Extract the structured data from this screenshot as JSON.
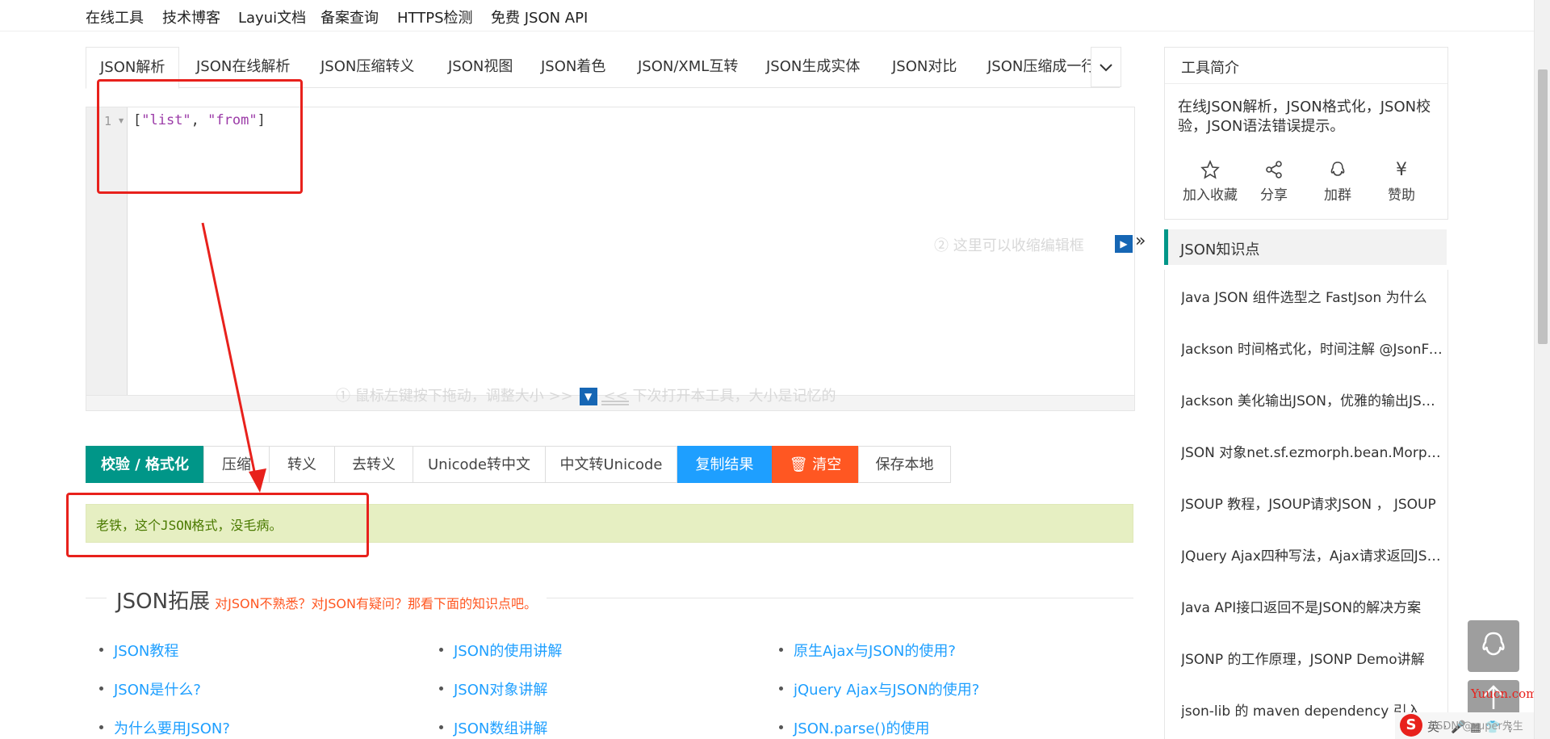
{
  "topnav": [
    "在线工具",
    "技术博客",
    "Layui文档",
    "备案查询",
    "HTTPS检测",
    "免费 JSON API"
  ],
  "tabs": [
    "JSON解析",
    "JSON在线解析",
    "JSON压缩转义",
    "JSON视图",
    "JSON着色",
    "JSON/XML互转",
    "JSON生成实体",
    "JSON对比",
    "JSON压缩成一行"
  ],
  "editor": {
    "line_number": "1",
    "code_open": "[",
    "str1": "\"list\"",
    "comma": ", ",
    "str2": "\"from\"",
    "code_close": "]",
    "hint_resize_left": "① 鼠标左键按下拖动，调整大小 >>",
    "hint_resize_right": "<< 下次打开本工具，大小是记忆的",
    "hint_collapse": "② 这里可以收缩编辑框"
  },
  "buttons": {
    "validate": "校验 / 格式化",
    "compress": "压缩",
    "escape": "转义",
    "unescape": "去转义",
    "unicode_to_cn": "Unicode转中文",
    "cn_to_unicode": "中文转Unicode",
    "copy": "复制结果",
    "clear": "清空",
    "save": "保存本地"
  },
  "result": "老铁，这个JSON格式，没毛病。",
  "extension": {
    "title": "JSON拓展",
    "subtitle": "对JSON不熟悉？对JSON有疑问？那看下面的知识点吧。",
    "col1": [
      "JSON教程",
      "JSON是什么?",
      "为什么要用JSON?"
    ],
    "col2": [
      "JSON的使用讲解",
      "JSON对象讲解",
      "JSON数组讲解"
    ],
    "col3": [
      "原生Ajax与JSON的使用?",
      "jQuery Ajax与JSON的使用?",
      "JSON.parse()的使用"
    ]
  },
  "sidebar": {
    "intro_title": "工具简介",
    "intro_desc": "在线JSON解析，JSON格式化，JSON校验，JSON语法错误提示。",
    "actions": [
      {
        "label": "加入收藏",
        "icon": "star-icon"
      },
      {
        "label": "分享",
        "icon": "share-icon"
      },
      {
        "label": "加群",
        "icon": "qq-icon"
      },
      {
        "label": "赞助",
        "icon": "yen-icon"
      }
    ],
    "knowledge_title": "JSON知识点",
    "knowledge_items": [
      "Java JSON 组件选型之 FastJson 为什么",
      "Jackson 时间格式化，时间注解 @JsonFormat",
      "Jackson 美化输出JSON，优雅的输出JSON数据",
      "JSON 对象net.sf.ezmorph.bean.MorphDynaBean",
      "JSOUP 教程，JSOUP请求JSON ， JSOUP",
      "JQuery Ajax四种写法，Ajax请求返回JSON",
      "Java API接口返回不是JSON的解决方案",
      "JSONP 的工作原理，JSONP Demo讲解",
      "json-lib 的 maven dependency 引入及Ja"
    ]
  },
  "watermark": "Yuucn.com",
  "tray": {
    "ime": "S",
    "text": "英 · 🎤 ▦ 👕 ⋮",
    "csdn": "CSDN @super先生"
  }
}
